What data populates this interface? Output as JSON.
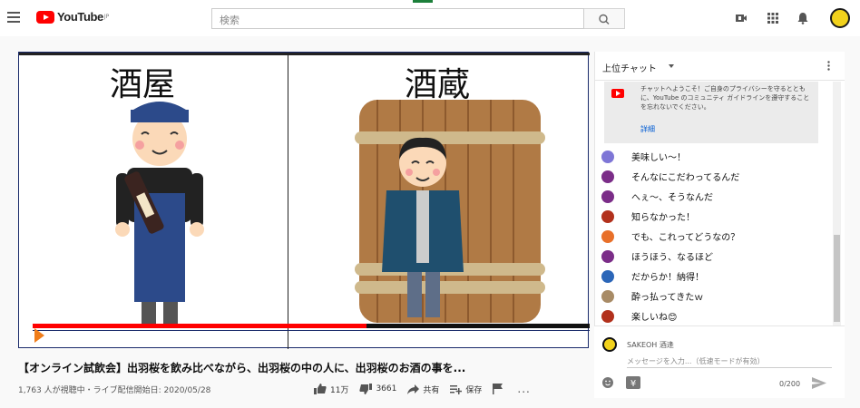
{
  "header": {
    "logo_text": "YouTube",
    "logo_region": "JP",
    "search_placeholder": "検索"
  },
  "video": {
    "left_label": "酒屋",
    "right_label": "酒蔵",
    "progress": 0.6,
    "title": "【オンライン試飲会】出羽桜を飲み比べながら、出羽桜の中の人に、出羽桜のお酒の事を...",
    "views_line": "1,763 人が視聴中・ライブ配信開始日: 2020/05/28",
    "likes": "11万",
    "dislikes": "3661",
    "share_label": "共有",
    "save_label": "保存",
    "more_label": "..."
  },
  "chat": {
    "header_title": "上位チャット",
    "welcome_text": "チャットへようこそ！ご自身のプライバシーを守るとともに、YouTube のコミュニティ ガイドラインを遵守することを忘れないでください。",
    "details_label": "詳細",
    "messages": [
      {
        "text": "美味しい～！",
        "color": "#7e76d6"
      },
      {
        "text": "そんなにこだわってるんだ",
        "color": "#7b2d88"
      },
      {
        "text": "へぇ～、そうなんだ",
        "color": "#7b2d88"
      },
      {
        "text": "知らなかった！",
        "color": "#b2311c"
      },
      {
        "text": "でも、これってどうなの？",
        "color": "#e8702a"
      },
      {
        "text": "ほうほう、なるほど",
        "color": "#7b2d88"
      },
      {
        "text": "だからか！納得！",
        "color": "#2b66b8"
      },
      {
        "text": "酔っ払ってきたｗ",
        "color": "#a88b66"
      },
      {
        "text": "楽しいね😊",
        "color": "#b2311c"
      }
    ],
    "user_name": "SAKEOH 酒逢",
    "input_placeholder": "メッセージを入力...（低速モードが有効）",
    "char_count": "0/200"
  }
}
